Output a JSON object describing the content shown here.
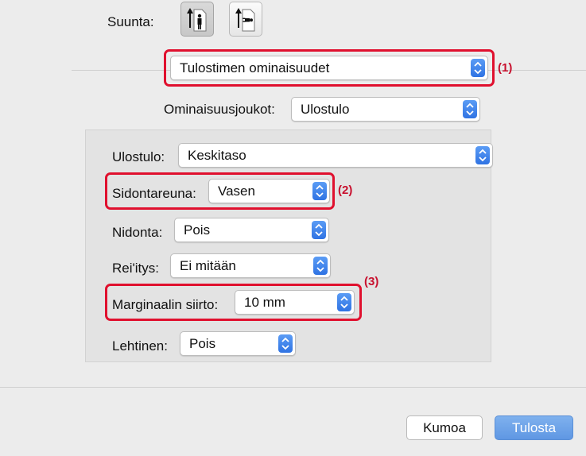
{
  "orientation": {
    "label": "Suunta:",
    "options": [
      {
        "name": "portrait",
        "icon": "portrait-person-icon",
        "selected": true
      },
      {
        "name": "landscape",
        "icon": "landscape-person-icon",
        "selected": false
      }
    ]
  },
  "panel_menu": {
    "value": "Tulostimen ominaisuudet",
    "callout": "(1)"
  },
  "feature_sets": {
    "label": "Ominaisuusjoukot:",
    "value": "Ulostulo"
  },
  "options": {
    "output": {
      "label": "Ulostulo:",
      "value": "Keskitaso"
    },
    "binding_edge": {
      "label": "Sidontareuna:",
      "value": "Vasen",
      "callout": "(2)"
    },
    "staple": {
      "label": "Nidonta:",
      "value": "Pois"
    },
    "punch": {
      "label": "Rei'itys:",
      "value": "Ei mitään"
    },
    "margin_shift": {
      "label": "Marginaalin siirto:",
      "value": "10 mm",
      "callout": "(3)"
    },
    "booklet": {
      "label": "Lehtinen:",
      "value": "Pois"
    }
  },
  "buttons": {
    "cancel": "Kumoa",
    "print": "Tulosta"
  },
  "colors": {
    "accent": "#2f73e3",
    "callout": "#e0102e",
    "primary_button": "#6fa3ea"
  }
}
